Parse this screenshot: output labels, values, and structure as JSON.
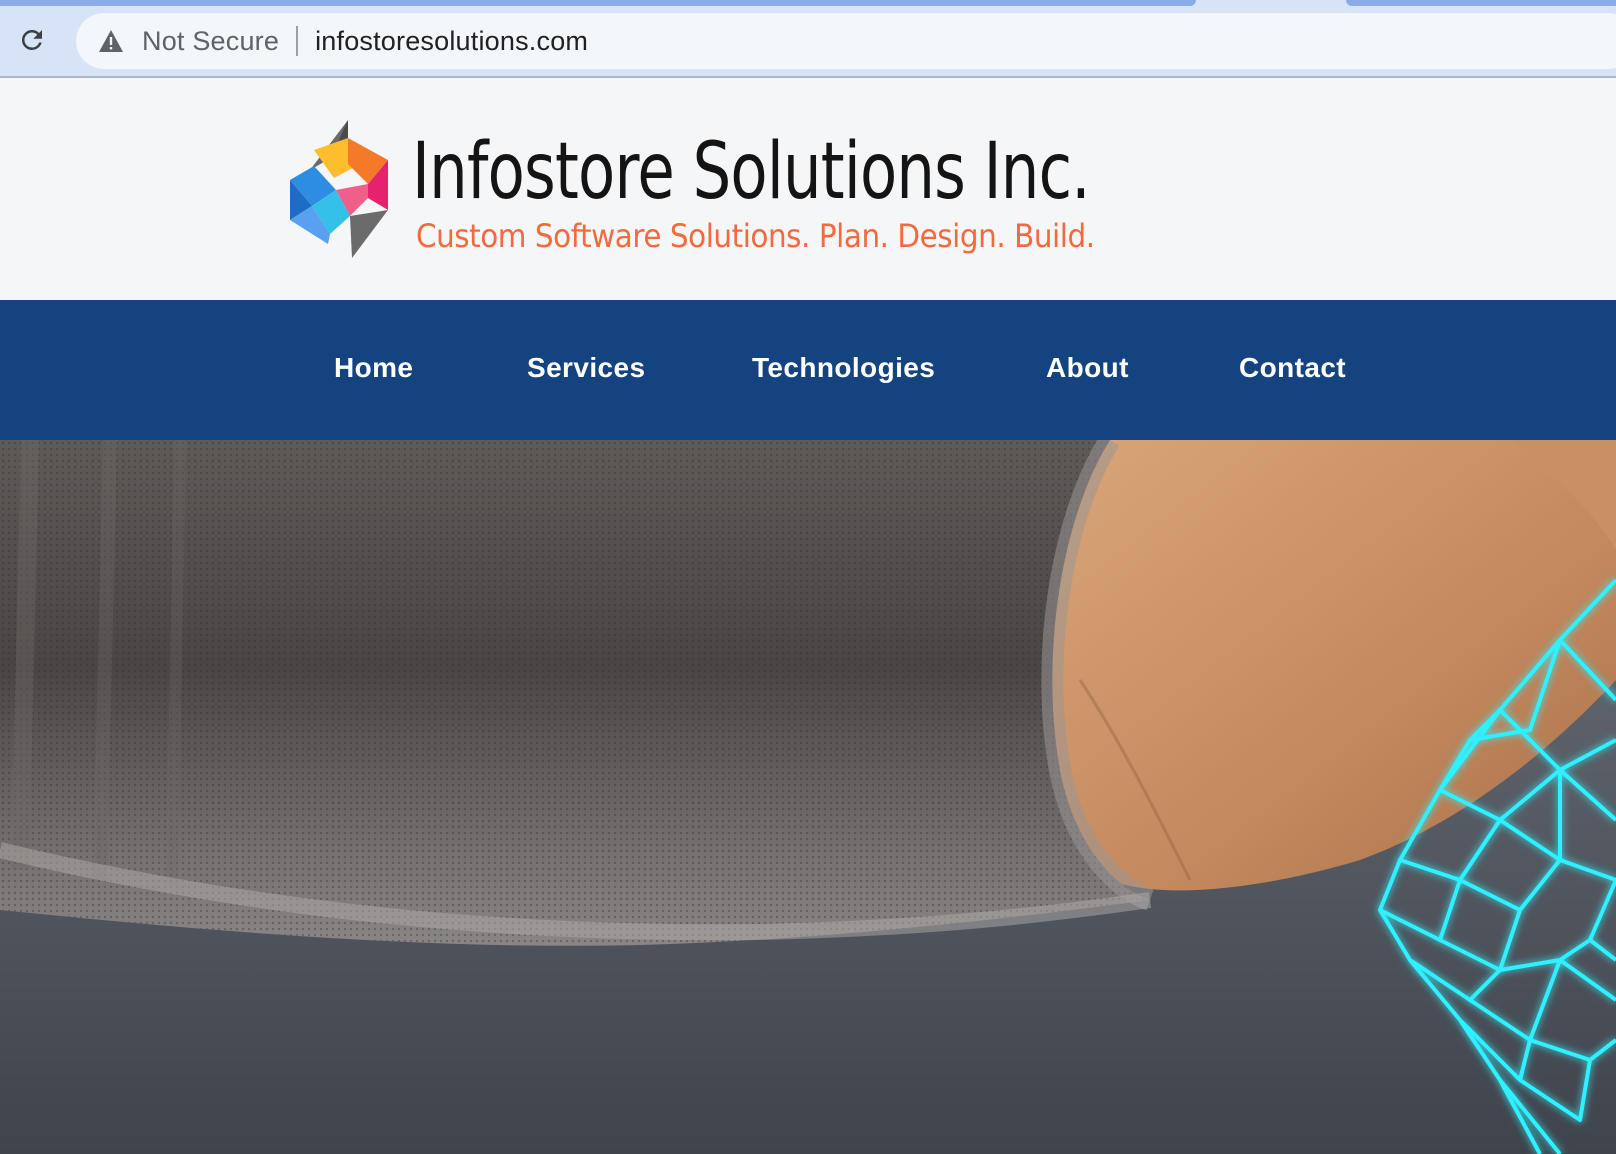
{
  "browser": {
    "security_label": "Not Secure",
    "url": "infostoresolutions.com"
  },
  "brand": {
    "name": "Infostore Solutions Inc.",
    "tagline": "Custom Software Solutions. Plan. Design. Build.",
    "colors": {
      "name": "#141414",
      "tagline": "#f26a3d",
      "nav_background": "#15437f"
    }
  },
  "nav": {
    "items": [
      {
        "label": "Home"
      },
      {
        "label": "Services"
      },
      {
        "label": "Technologies"
      },
      {
        "label": "About"
      },
      {
        "label": "Contact"
      }
    ]
  },
  "hero": {
    "icons": [
      "sweater-sleeve-illustration",
      "hand-illustration",
      "wireframe-mesh-illustration"
    ]
  }
}
